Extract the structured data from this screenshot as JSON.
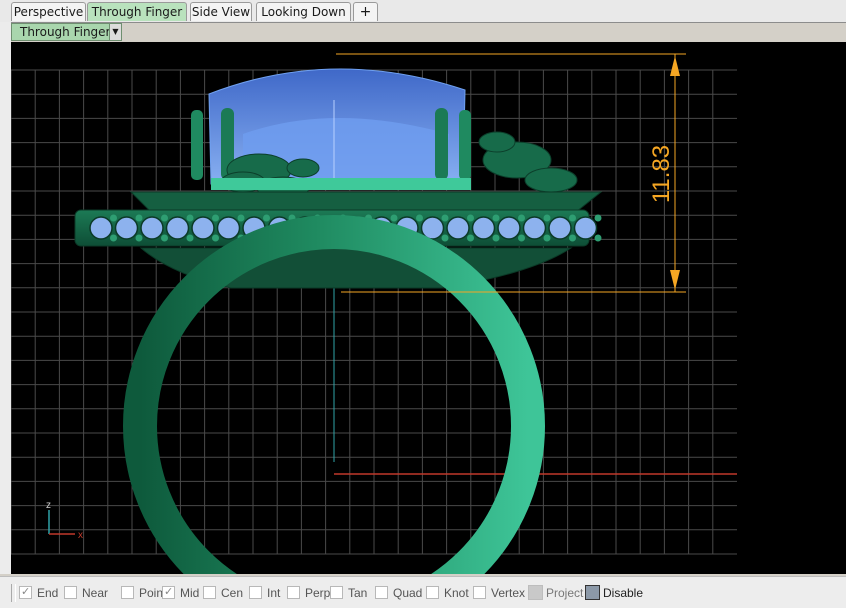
{
  "tabs": [
    {
      "label": "Perspective",
      "active": false
    },
    {
      "label": "Through Finger",
      "active": true
    },
    {
      "label": "Side View",
      "active": false
    },
    {
      "label": "Looking Down",
      "active": false
    }
  ],
  "add_tab_label": "+",
  "viewport": {
    "title": "Through Finger",
    "dimension_value": "11.83",
    "axis_labels": {
      "x": "x",
      "z": "z"
    },
    "colors": {
      "background": "#000000",
      "grid": "#4a4a4a",
      "ring_metal": "#1f7a55",
      "stone": "#5f8ee0",
      "dimension": "#f5a623",
      "axis_x": "#c0392b",
      "axis_z": "#2fa3a8"
    }
  },
  "status_bar": {
    "osnaps": [
      {
        "label": "End",
        "checked": true
      },
      {
        "label": "Near",
        "checked": false
      },
      {
        "label": "Point",
        "checked": false
      },
      {
        "label": "Mid",
        "checked": true
      },
      {
        "label": "Cen",
        "checked": false
      },
      {
        "label": "Int",
        "checked": false
      },
      {
        "label": "Perp",
        "checked": false
      },
      {
        "label": "Tan",
        "checked": false
      },
      {
        "label": "Quad",
        "checked": false
      },
      {
        "label": "Knot",
        "checked": false
      },
      {
        "label": "Vertex",
        "checked": false
      }
    ],
    "project_label": "Project",
    "disable_label": "Disable"
  }
}
